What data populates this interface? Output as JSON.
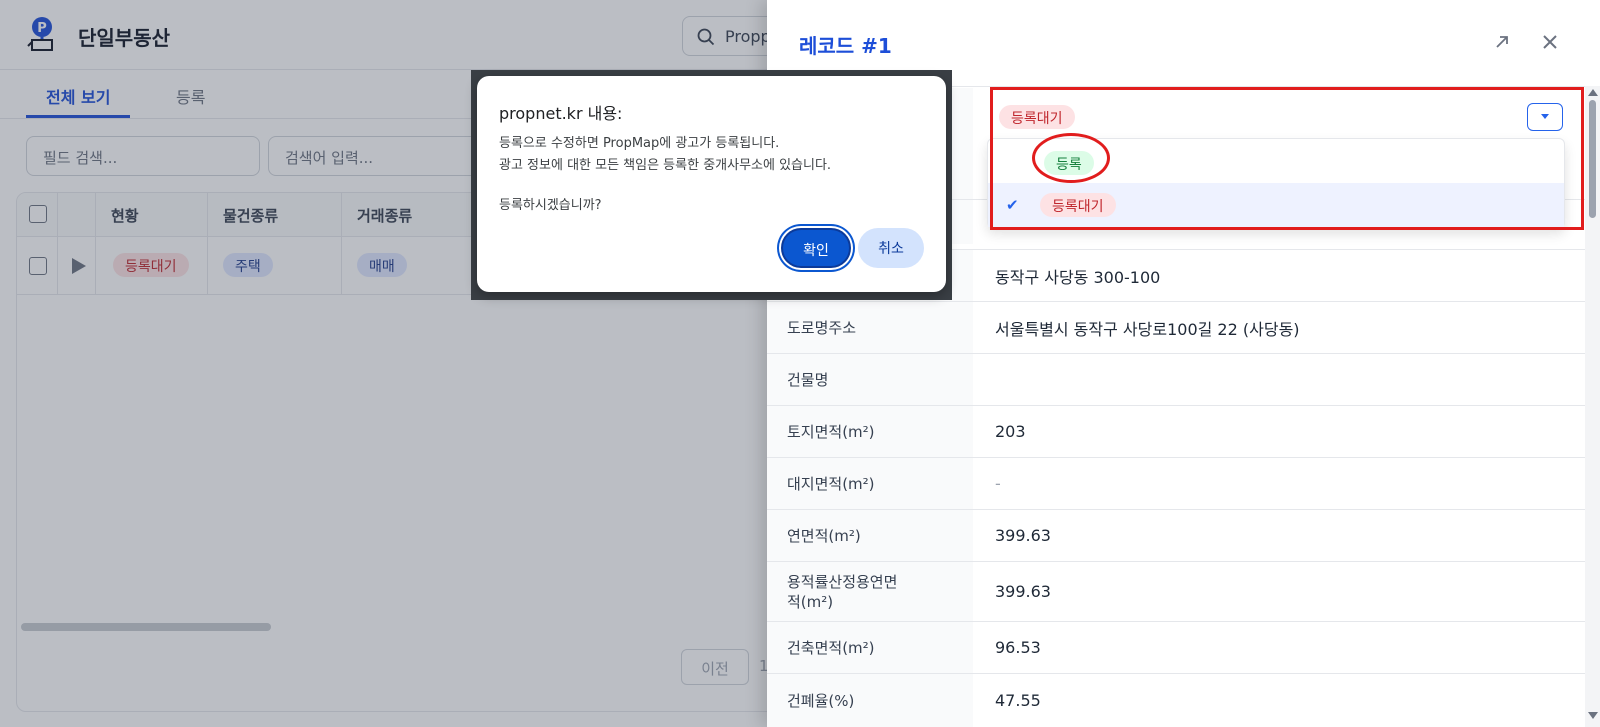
{
  "app": {
    "brand": "단일부동산",
    "search_value": "Propp",
    "tabs": [
      "전체 보기",
      "등록"
    ],
    "filters": {
      "field_placeholder": "필드 검색...",
      "keyword_placeholder": "검색어 입력..."
    },
    "table": {
      "headers": [
        "현황",
        "물건종류",
        "거래종류"
      ],
      "row": {
        "status": "등록대기",
        "property_type": "주택",
        "deal_type": "매매"
      }
    },
    "pager": {
      "prev": "이전",
      "page": "1"
    }
  },
  "panel": {
    "title": "레코드 #1",
    "status": {
      "current": "등록대기",
      "options": [
        "등록",
        "등록대기"
      ],
      "selected_check": "✔"
    },
    "fields": [
      {
        "label": "",
        "value": "동작구 사당동 300-100"
      },
      {
        "label": "도로명주소",
        "value": "서울특별시 동작구 사당로100길 22 (사당동)"
      },
      {
        "label": "건물명",
        "value": ""
      },
      {
        "label": "토지면적(m²)",
        "value": "203"
      },
      {
        "label": "대지면적(m²)",
        "value": "-"
      },
      {
        "label": "연면적(m²)",
        "value": "399.63"
      },
      {
        "label": "용적률산정용연면\n적(m²)",
        "value": "399.63"
      },
      {
        "label": "건축면적(m²)",
        "value": "96.53"
      },
      {
        "label": "건폐율(%)",
        "value": "47.55"
      }
    ]
  },
  "dialog": {
    "title": "propnet.kr 내용:",
    "line1": "등록으로 수정하면 PropMap에 광고가 등록됩니다.",
    "line2": "광고 정보에 대한 모든 책임은 등록한 중개사무소에 있습니다.",
    "line3": "등록하시겠습니까?",
    "ok": "확인",
    "cancel": "취소"
  },
  "colors": {
    "accent": "#1d4ed8",
    "annotation": "#e11d1d",
    "pending_bg": "#fde2e4",
    "registered_bg": "#dcfce7"
  }
}
